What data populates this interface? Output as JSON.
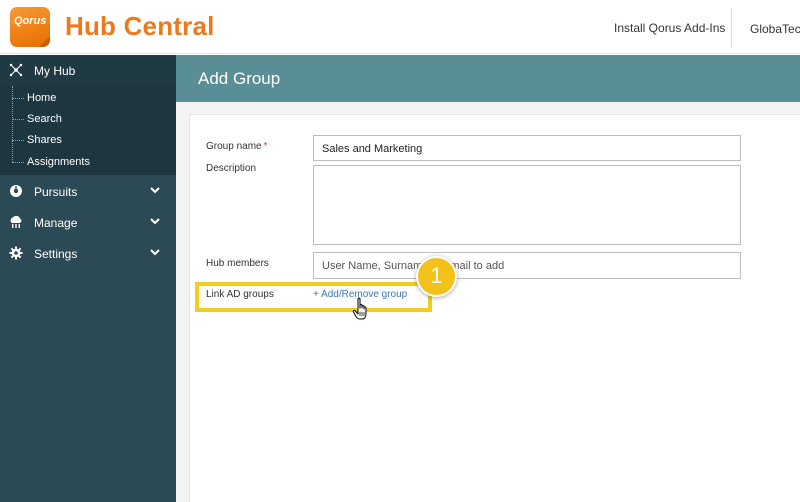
{
  "header": {
    "logo_text": "Qorus",
    "app_title": "Hub Central",
    "install_link": "Install Qorus Add-Ins",
    "org_label": "GlobaTech",
    "brand_color": "#ec7a1c"
  },
  "sidebar": {
    "my_hub": {
      "label": "My Hub",
      "icon": "hub-icon"
    },
    "sub_items": [
      {
        "label": "Home"
      },
      {
        "label": "Search"
      },
      {
        "label": "Shares"
      },
      {
        "label": "Assignments"
      }
    ],
    "sections": [
      {
        "label": "Pursuits",
        "icon": "pursuits-icon"
      },
      {
        "label": "Manage",
        "icon": "manage-icon"
      },
      {
        "label": "Settings",
        "icon": "gear-icon"
      }
    ]
  },
  "main": {
    "title": "Add Group",
    "form": {
      "group_name_label": "Group name",
      "group_name_required": "*",
      "group_name_value": "Sales and Marketing",
      "description_label": "Description",
      "description_value": "",
      "hub_members_label": "Hub members",
      "hub_members_placeholder": "User Name, Surname or email to add",
      "link_ad_label": "Link AD groups",
      "add_remove_link": "+ Add/Remove group"
    },
    "callout_number": "1"
  }
}
